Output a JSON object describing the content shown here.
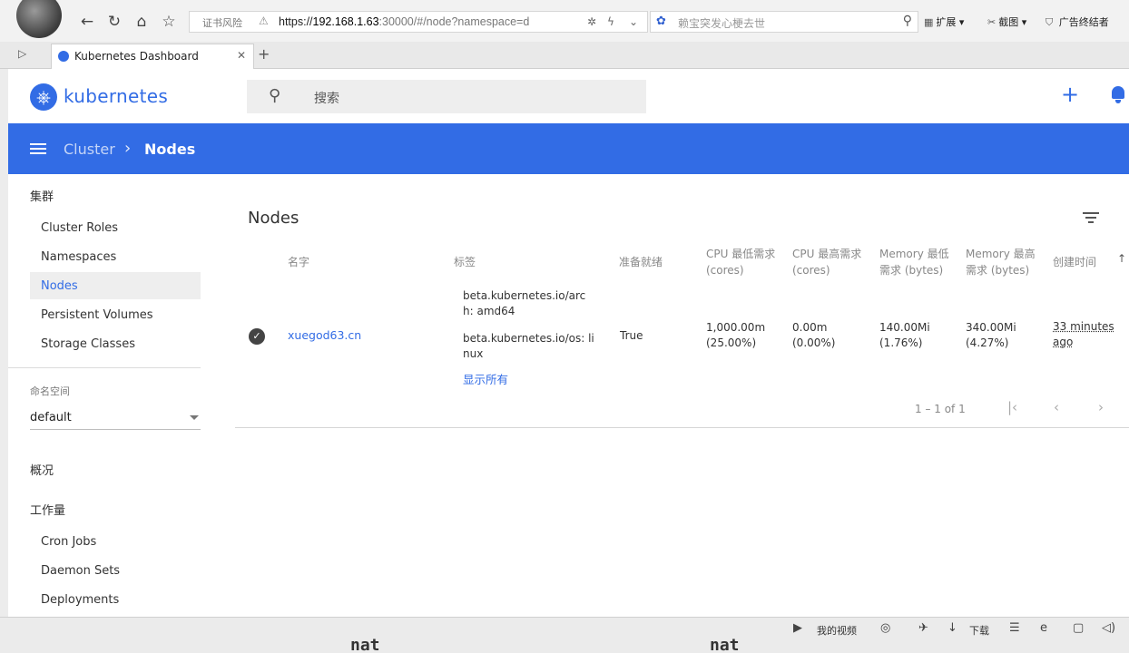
{
  "browser": {
    "cert_warning": "证书风险",
    "url_scheme": "https://",
    "url_host": "192.168.1.63",
    "url_rest": ":30000/#/node?namespace=d",
    "search_placeholder": "赖宝突发心梗去世",
    "ext_label": "扩展",
    "screenshot_label": "截图",
    "adblock_label": "广告终结者",
    "tab_title": "Kubernetes Dashboard"
  },
  "app": {
    "brand": "kubernetes",
    "search_placeholder": "搜索"
  },
  "breadcrumb": {
    "parent": "Cluster",
    "current": "Nodes"
  },
  "sidebar": {
    "cluster_heading": "集群",
    "cluster_items": [
      "Cluster Roles",
      "Namespaces",
      "Nodes",
      "Persistent Volumes",
      "Storage Classes"
    ],
    "namespace_label": "命名空间",
    "namespace_value": "default",
    "overview_heading": "概况",
    "workloads_heading": "工作量",
    "workload_items": [
      "Cron Jobs",
      "Daemon Sets",
      "Deployments"
    ]
  },
  "nodes_card": {
    "title": "Nodes",
    "columns": {
      "name": "名字",
      "labels": "标签",
      "ready": "准备就绪",
      "cpu_req_1": "CPU 最低需求",
      "cpu_req_2": "(cores)",
      "cpu_lim_1": "CPU 最高需求",
      "cpu_lim_2": "(cores)",
      "mem_req_1": "Memory 最低",
      "mem_req_2": "需求 (bytes)",
      "mem_lim_1": "Memory 最高",
      "mem_lim_2": "需求 (bytes)",
      "created": "创建时间"
    },
    "row": {
      "name": "xuegod63.cn",
      "label1_a": "beta.kubernetes.io/arc",
      "label1_b": "h: amd64",
      "label2_a": "beta.kubernetes.io/os: li",
      "label2_b": "nux",
      "show_all": "显示所有",
      "ready": "True",
      "cpu_req": "1,000.00m",
      "cpu_req_pct": "(25.00%)",
      "cpu_lim": "0.00m",
      "cpu_lim_pct": "(0.00%)",
      "mem_req": "140.00Mi",
      "mem_req_pct": "(1.76%)",
      "mem_lim": "340.00Mi",
      "mem_lim_pct": "(4.27%)",
      "created_1": "33 minutes",
      "created_2": "ago"
    },
    "pagination": "1 – 1 of 1"
  },
  "statusbar": {
    "video_label": "我的视频",
    "download_label": "下载",
    "bg_text_1": "nat",
    "bg_text_2": "nat"
  },
  "colors": {
    "primary": "#326ce5",
    "toolbar_text": "#ffffff",
    "chrome_bg": "#f2f2f2"
  }
}
